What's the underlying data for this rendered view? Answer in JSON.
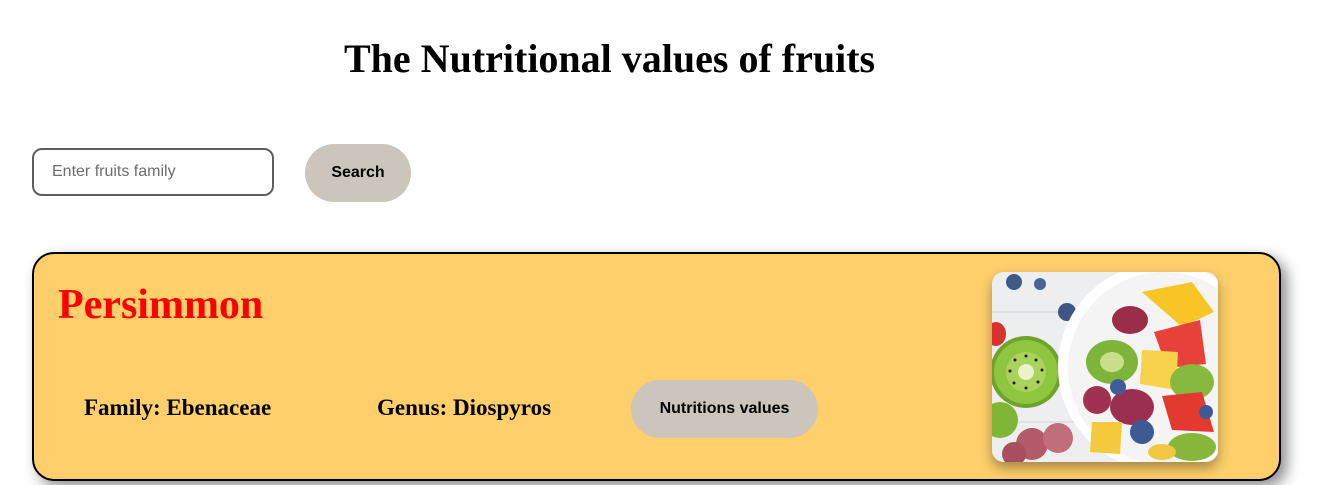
{
  "header": {
    "title": "The Nutritional values of fruits"
  },
  "search": {
    "placeholder": "Enter fruits family",
    "value": "",
    "button_label": "Search"
  },
  "card": {
    "name": "Persimmon",
    "family": "Family: Ebenaceae",
    "genus": "Genus: Diospyros",
    "nutrition_button_label": "Nutritions values",
    "image_description_icon": "fruit-salad-image",
    "background_color": "#fecf6a",
    "name_color": "#ff0000"
  },
  "colors": {
    "button_bg": "#cbc5bb"
  }
}
